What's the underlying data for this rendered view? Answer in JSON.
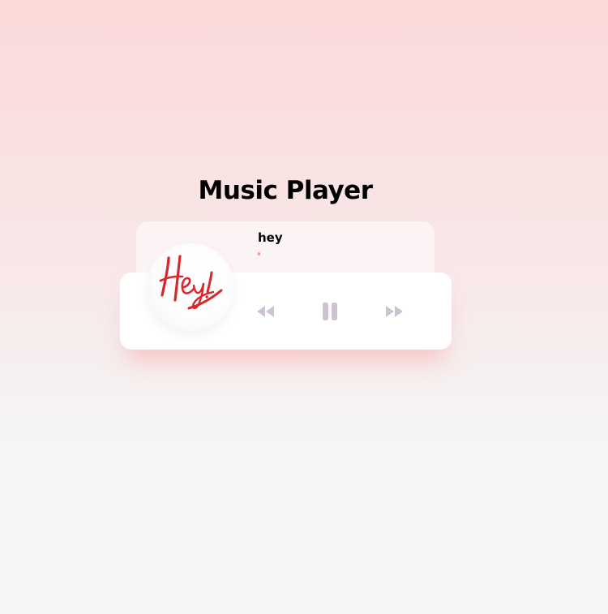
{
  "page": {
    "title": "Music Player"
  },
  "track": {
    "title": "hey",
    "progress_fraction": 0.01
  },
  "album_art": {
    "lettering": "Hey!",
    "lettering_color": "#d8262b"
  },
  "controls": {
    "previous_icon": "backward-icon",
    "play_pause_icon": "pause-icon",
    "next_icon": "forward-icon",
    "icon_color": "#cdc2d0"
  },
  "colors": {
    "progress_fill": "#fe8daa",
    "background_top": "#fbd9d9",
    "background_bottom": "#f5f5f5"
  }
}
